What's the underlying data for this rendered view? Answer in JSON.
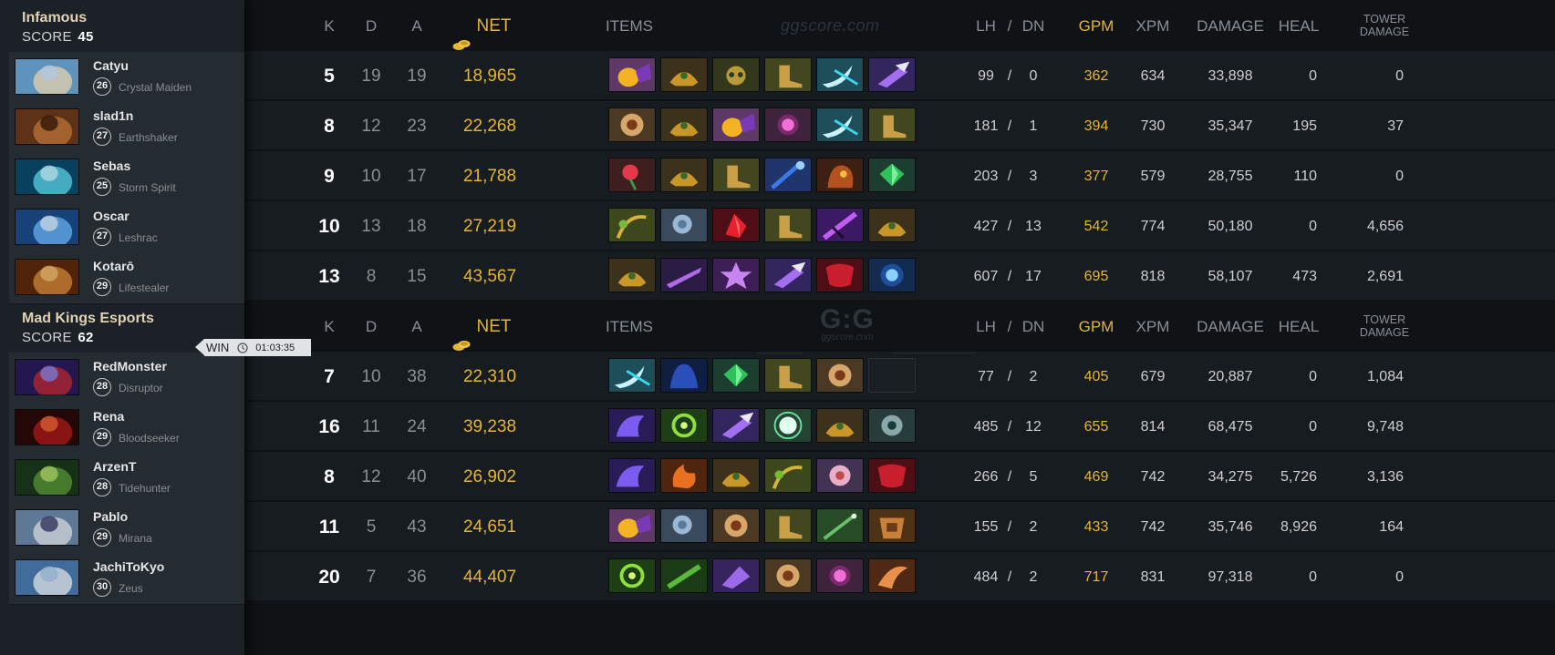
{
  "colors": {
    "gold": "#e5b533",
    "muted": "#8a8f94",
    "team_name": "#e1d2b4"
  },
  "watermark": {
    "top": "ggscore.com",
    "logo": "G:G",
    "logo_sub": "ggscore.com"
  },
  "columns": {
    "k": "K",
    "d": "D",
    "a": "A",
    "net": "NET",
    "items": "ITEMS",
    "lh": "LH",
    "slash": "/",
    "dn": "DN",
    "gpm": "GPM",
    "xpm": "XPM",
    "damage": "DAMAGE",
    "heal": "HEAL",
    "tower_line1": "TOWER",
    "tower_line2": "DAMAGE"
  },
  "result": {
    "label": "WIN",
    "duration": "01:03:35"
  },
  "teams": [
    {
      "name": "Infamous",
      "score_label": "SCORE",
      "score": "45",
      "players": [
        {
          "name": "Catyu",
          "level": "26",
          "hero": "Crystal Maiden",
          "k": "5",
          "d": "19",
          "a": "19",
          "net": "18,965",
          "lh": "99",
          "dn": "0",
          "gpm": "362",
          "xpm": "634",
          "damage": "33,898",
          "heal": "0",
          "tower": "0",
          "items": [
            "flask-item",
            "helm-item",
            "skull-item",
            "boots-item",
            "hook-item",
            "claw-item"
          ]
        },
        {
          "name": "slad1n",
          "level": "27",
          "hero": "Earthshaker",
          "k": "8",
          "d": "12",
          "a": "23",
          "net": "22,268",
          "lh": "181",
          "dn": "1",
          "gpm": "394",
          "xpm": "730",
          "damage": "35,347",
          "heal": "195",
          "tower": "37",
          "items": [
            "shield-item",
            "helm-item",
            "flask-item",
            "orb-item",
            "hook-item",
            "boots-item"
          ]
        },
        {
          "name": "Sebas",
          "level": "25",
          "hero": "Storm Spirit",
          "k": "9",
          "d": "10",
          "a": "17",
          "net": "21,788",
          "lh": "203",
          "dn": "3",
          "gpm": "377",
          "xpm": "579",
          "damage": "28,755",
          "heal": "110",
          "tower": "0",
          "items": [
            "rose-item",
            "helm-item",
            "boots-item",
            "scepter-item",
            "hood-item",
            "gem-item"
          ]
        },
        {
          "name": "Oscar",
          "level": "27",
          "hero": "Leshrac",
          "k": "10",
          "d": "13",
          "a": "18",
          "net": "27,219",
          "lh": "427",
          "dn": "13",
          "gpm": "542",
          "xpm": "774",
          "damage": "50,180",
          "heal": "0",
          "tower": "4,656",
          "items": [
            "staff-item",
            "axe-item",
            "crystal-item",
            "boots-item",
            "dagger-item",
            "helm-item"
          ]
        },
        {
          "name": "Kotarō",
          "level": "29",
          "hero": "Lifestealer",
          "k": "13",
          "d": "8",
          "a": "15",
          "net": "43,567",
          "lh": "607",
          "dn": "17",
          "gpm": "695",
          "xpm": "818",
          "damage": "58,107",
          "heal": "473",
          "tower": "2,691",
          "items": [
            "helm-item",
            "blade-item",
            "star-item",
            "claw-item",
            "mask-item",
            "sphere-item"
          ]
        }
      ]
    },
    {
      "name": "Mad Kings Esports",
      "score_label": "SCORE",
      "score": "62",
      "players": [
        {
          "name": "RedMonster",
          "level": "28",
          "hero": "Disruptor",
          "k": "7",
          "d": "10",
          "a": "38",
          "net": "22,310",
          "lh": "77",
          "dn": "2",
          "gpm": "405",
          "xpm": "679",
          "damage": "20,887",
          "heal": "0",
          "tower": "1,084",
          "items": [
            "hook-item",
            "cloak-item",
            "gem-item",
            "boots-item",
            "shield-item",
            "empty-slot"
          ]
        },
        {
          "name": "Rena",
          "level": "29",
          "hero": "Bloodseeker",
          "k": "16",
          "d": "11",
          "a": "24",
          "net": "39,238",
          "lh": "485",
          "dn": "12",
          "gpm": "655",
          "xpm": "814",
          "damage": "68,475",
          "heal": "0",
          "tower": "9,748",
          "items": [
            "wing-item",
            "swirl-item",
            "claw-item",
            "burst-item",
            "helm-item",
            "dragon-item"
          ]
        },
        {
          "name": "ArzenT",
          "level": "28",
          "hero": "Tidehunter",
          "k": "8",
          "d": "12",
          "a": "40",
          "net": "26,902",
          "lh": "266",
          "dn": "5",
          "gpm": "469",
          "xpm": "742",
          "damage": "34,275",
          "heal": "5,726",
          "tower": "3,136",
          "items": [
            "wing-item",
            "fire-item",
            "helm-item",
            "staff-item",
            "flower-item",
            "mask-item"
          ]
        },
        {
          "name": "Pablo",
          "level": "29",
          "hero": "Mirana",
          "k": "11",
          "d": "5",
          "a": "43",
          "net": "24,651",
          "lh": "155",
          "dn": "2",
          "gpm": "433",
          "xpm": "742",
          "damage": "35,746",
          "heal": "8,926",
          "tower": "164",
          "items": [
            "flask-item",
            "axe-item",
            "shield-item",
            "boots-item",
            "wand-item",
            "armor-item"
          ]
        },
        {
          "name": "JachiToKyo",
          "level": "30",
          "hero": "Zeus",
          "k": "20",
          "d": "7",
          "a": "36",
          "net": "44,407",
          "lh": "484",
          "dn": "2",
          "gpm": "717",
          "xpm": "831",
          "damage": "97,318",
          "heal": "0",
          "tower": "0",
          "items": [
            "swirl-item",
            "sword-item",
            "cleaver-item",
            "shield-item",
            "orb-item",
            "horn-item"
          ]
        }
      ]
    }
  ]
}
